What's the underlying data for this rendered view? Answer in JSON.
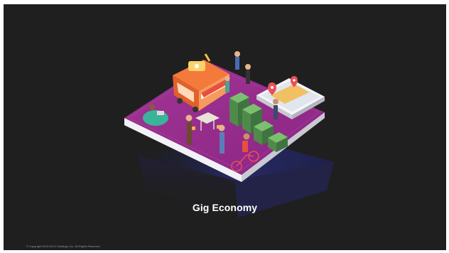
{
  "slide": {
    "title": "Gig Economy",
    "copyright": "© Copyright 2019 NCCI Holdings, Inc. All Rights Reserved."
  },
  "illustration": {
    "elements": [
      "isometric-platform",
      "food-truck",
      "money-stacks",
      "smartphone-map",
      "map-pin-icon",
      "cyclist",
      "beanbag-worker",
      "cafe-table"
    ]
  },
  "colors": {
    "slide_background": "#1f1f1f",
    "frame": "#ffffff",
    "platform_top": "#9b2d8f",
    "platform_edge": "#e9e9ee",
    "money": "#4f8a4a",
    "truck_orange": "#f37a3b",
    "title_text": "#ffffff"
  }
}
